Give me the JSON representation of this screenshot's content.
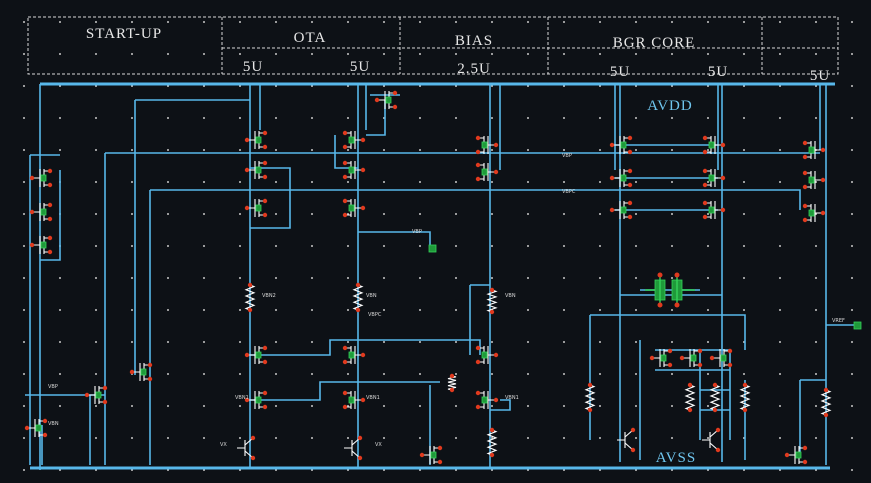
{
  "header": {
    "sections": [
      {
        "label": "START-UP",
        "currents": []
      },
      {
        "label": "OTA",
        "currents": [
          "5U",
          "5U"
        ]
      },
      {
        "label": "BIAS",
        "currents": [
          "2.5U"
        ]
      },
      {
        "label": "BGR CORE",
        "currents": [
          "5U",
          "5U"
        ]
      },
      {
        "label": "",
        "currents": [
          "5U"
        ]
      }
    ]
  },
  "rails": {
    "top": "AVDD",
    "bottom": "AVSS"
  },
  "nets": {
    "vbp_mid": "VBP",
    "vbpc_mid": "VBPC",
    "vbp_out": "VBP",
    "vbn2": "VBN2",
    "vbn": "VBN",
    "vbpc_lbl": "VBPC",
    "vbn_bias": "VBN",
    "vbn1_a": "VBN1",
    "vbn1_b": "VBN1",
    "vbn1_c": "VBN1",
    "vref": "VREF",
    "vbp_start": "VBP",
    "vbn_start": "VBN",
    "vx_a": "VX",
    "vx_b": "VX"
  }
}
